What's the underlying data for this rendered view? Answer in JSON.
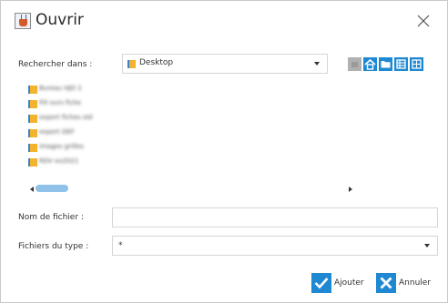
{
  "window": {
    "title": "Ouvrir",
    "app_icon": "java-cup-icon",
    "close_icon": "close-icon"
  },
  "look_in": {
    "label": "Rechercher dans :",
    "value": "Desktop",
    "icon": "folder-icon"
  },
  "toolbar": {
    "buttons": [
      {
        "name": "up-folder-icon",
        "enabled": false
      },
      {
        "name": "home-icon",
        "enabled": true
      },
      {
        "name": "new-folder-icon",
        "enabled": true
      },
      {
        "name": "list-view-icon",
        "enabled": true
      },
      {
        "name": "details-view-icon",
        "enabled": true
      }
    ],
    "accent_color": "#1e88d2"
  },
  "file_list": {
    "items": [
      {
        "name": "Bureau HJO 2",
        "icon": "folder-icon"
      },
      {
        "name": "Fill ours fiche",
        "icon": "folder-icon"
      },
      {
        "name": "export fiches old",
        "icon": "folder-icon"
      },
      {
        "name": "export DEF",
        "icon": "folder-icon"
      },
      {
        "name": "images grilles",
        "icon": "folder-icon"
      },
      {
        "name": "RDV ex2021",
        "icon": "folder-icon"
      }
    ],
    "folder_color": "#f2b32e"
  },
  "filename": {
    "label": "Nom de fichier :",
    "value": ""
  },
  "filetype": {
    "label": "Fichiers du type :",
    "value": "*"
  },
  "actions": {
    "add_label": "Ajouter",
    "cancel_label": "Annuler",
    "add_color": "#1e88d2",
    "cancel_color": "#1e88d2"
  }
}
